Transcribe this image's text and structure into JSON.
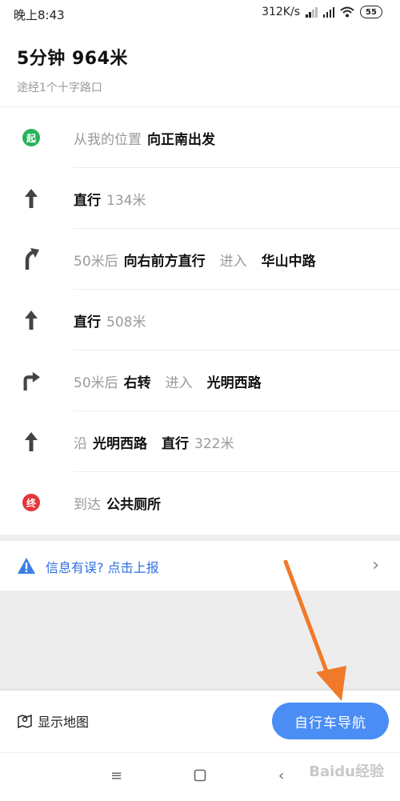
{
  "status_bar": {
    "time": "晚上8:43",
    "speed": "312K/s",
    "battery": "55"
  },
  "summary": {
    "title": "5分钟  964米",
    "subtitle": "途经1个十字路口"
  },
  "steps": [
    {
      "icon": "start-badge",
      "badge_text": "起",
      "muted": "从我的位置",
      "bold": "向正南出发"
    },
    {
      "icon": "arrow-up-icon",
      "bold": "直行",
      "muted": "134米"
    },
    {
      "icon": "turn-slight-right-icon",
      "muted": "50米后",
      "bold": "向右前方直行",
      "muted2": "进入",
      "bold2": "华山中路"
    },
    {
      "icon": "arrow-up-icon",
      "bold": "直行",
      "muted": "508米"
    },
    {
      "icon": "turn-right-icon",
      "muted": "50米后",
      "bold": "右转",
      "muted2": "进入",
      "bold2": "光明西路"
    },
    {
      "icon": "arrow-up-icon",
      "muted": "沿",
      "bold": "光明西路",
      "bold2": "直行",
      "muted2": "322米"
    },
    {
      "icon": "end-badge",
      "badge_text": "终",
      "muted": "到达",
      "bold": "公共厕所"
    }
  ],
  "report": {
    "label": "信息有误? 点击上报",
    "icon": "warning-icon"
  },
  "bottom": {
    "show_map": "显示地图",
    "nav_button": "自行车导航"
  },
  "watermark": "Baidu经验",
  "colors": {
    "accent": "#4a8df4",
    "start": "#27b35b",
    "end": "#e5353c",
    "link": "#2f6fe0",
    "annotation": "#f07a2a"
  }
}
